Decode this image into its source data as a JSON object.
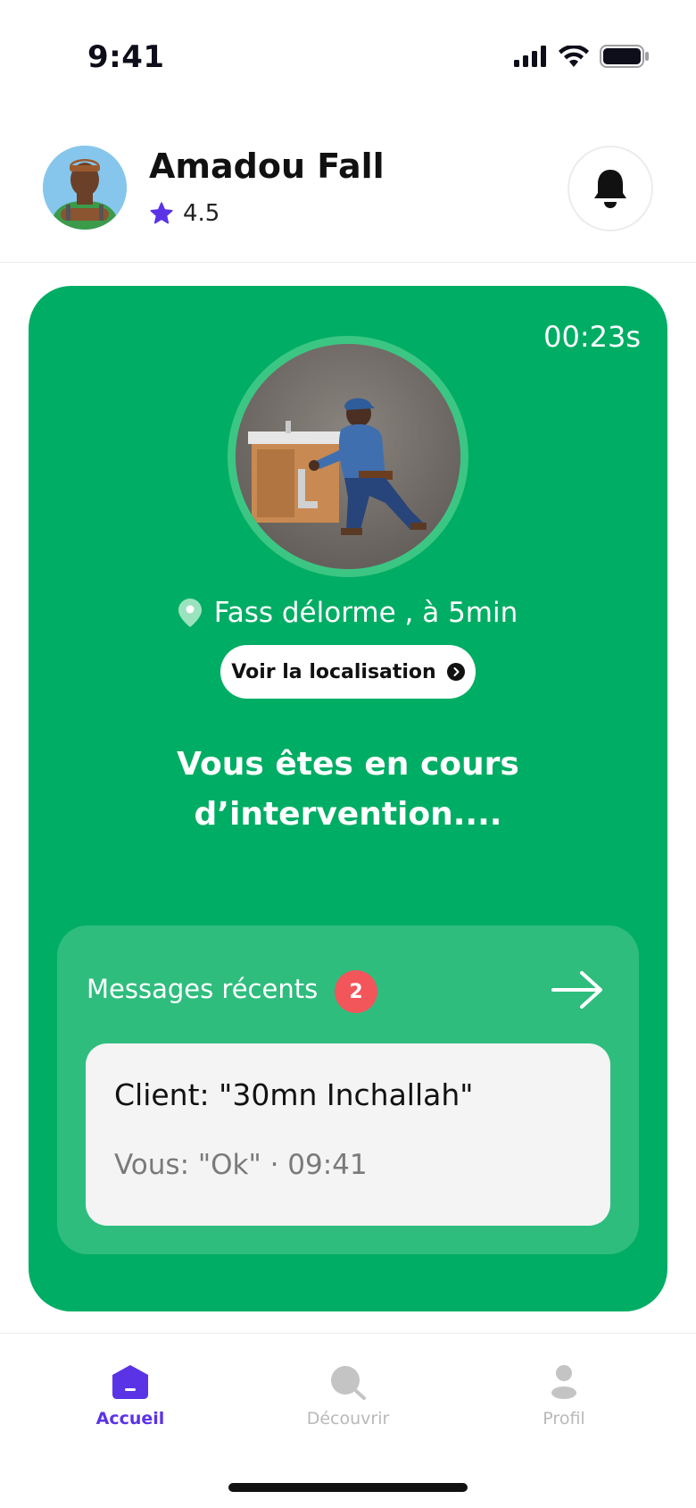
{
  "status_bar": {
    "time": "9:41"
  },
  "header": {
    "name": "Amadou Fall",
    "rating": "4.5"
  },
  "card": {
    "timer": "00:23s",
    "location": "Fass délorme , à 5min",
    "location_button": "Voir la localisation",
    "status_line1": "Vous êtes en cours",
    "status_line2": "d’intervention....",
    "messages": {
      "title": "Messages récents",
      "badge": "2",
      "client_message": "Client: \"30mn Inchallah\"",
      "reply": "Vous: \"Ok\" · 09:41"
    }
  },
  "tabbar": {
    "tabs": [
      {
        "label": "Accueil",
        "icon": "home-icon",
        "active": true
      },
      {
        "label": "Découvrir",
        "icon": "search-icon",
        "active": false
      },
      {
        "label": "Profil",
        "icon": "profile-icon",
        "active": false
      }
    ]
  },
  "colors": {
    "card_green": "#00ad64",
    "accent_purple": "#5b33e6",
    "badge_red": "#f2555a"
  }
}
